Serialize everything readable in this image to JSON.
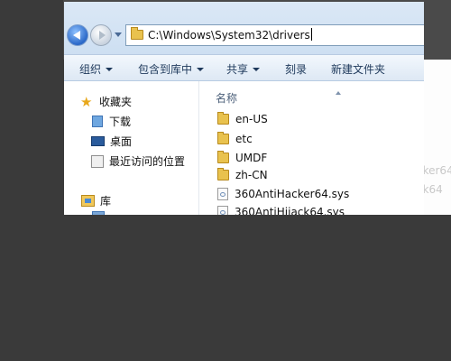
{
  "address": {
    "path": "C:\\Windows\\System32\\drivers"
  },
  "toolbar": {
    "organize": "组织",
    "include_in_library": "包含到库中",
    "share": "共享",
    "burn": "刻录",
    "new_folder": "新建文件夹"
  },
  "navpane": {
    "favorites": "收藏夹",
    "downloads": "下载",
    "desktop": "桌面",
    "recent": "最近访问的位置",
    "libraries": "库"
  },
  "content": {
    "column_name": "名称",
    "files": [
      {
        "name": "en-US",
        "type": "folder"
      },
      {
        "name": "etc",
        "type": "folder"
      },
      {
        "name": "UMDF",
        "type": "folder"
      },
      {
        "name": "zh-CN",
        "type": "folder"
      },
      {
        "name": "360AntiHacker64.sys",
        "type": "sys"
      },
      {
        "name": "360AntiHijack64.sys",
        "type": "sys"
      }
    ]
  },
  "ghost": {
    "line1": "cker64",
    "line2": "ck64"
  },
  "colors": {
    "desktop_bg": "#3a3a3a",
    "toolbar_text": "#1e395b",
    "folder": "#e9c24e"
  }
}
